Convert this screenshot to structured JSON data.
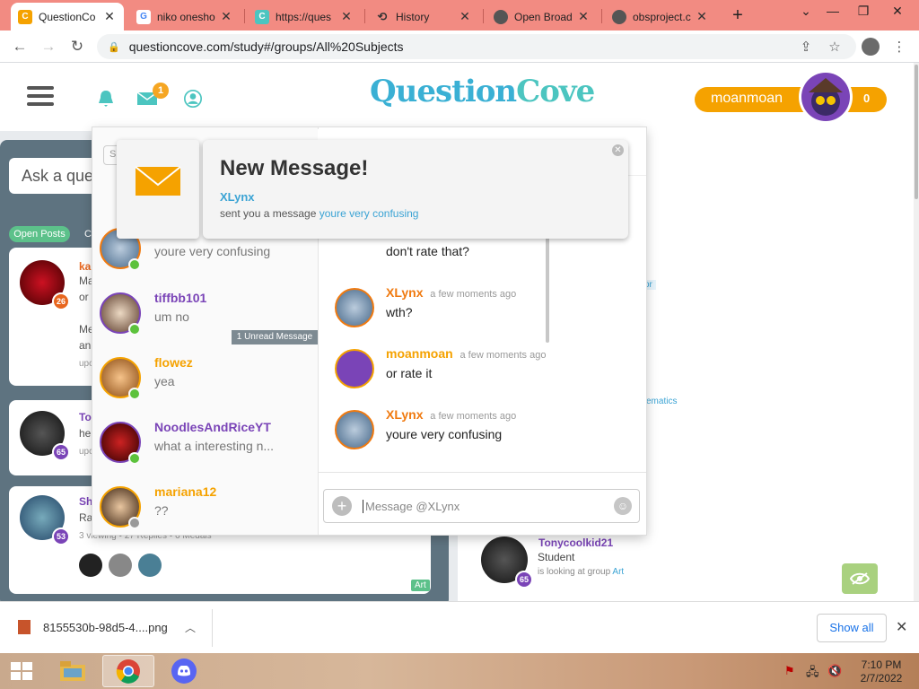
{
  "browser": {
    "tabs": [
      {
        "title": "QuestionCo",
        "active": true
      },
      {
        "title": "niko onesho"
      },
      {
        "title": "https://ques"
      },
      {
        "title": "History"
      },
      {
        "title": "Open Broad"
      },
      {
        "title": "obsproject.c"
      }
    ],
    "url": "questioncove.com/study#/groups/All%20Subjects"
  },
  "site": {
    "logo_text_a": "Question",
    "logo_text_b": "Cove",
    "mail_badge": "1",
    "username": "moanmoan",
    "points": "0",
    "ask_placeholder": "Ask a ques",
    "filters": {
      "open_posts": "Open Posts",
      "other": "Cl"
    },
    "feed": [
      {
        "user": "ka",
        "snippet1": "Ma",
        "snippet2": "or",
        "snippet3": "Me",
        "snippet4": "an",
        "meta": "upc",
        "level": "26",
        "level_color": "#e8661e"
      },
      {
        "user": "To",
        "snippet1": "hel",
        "meta": "upc",
        "level": "65",
        "level_color": "#7a44b7"
      },
      {
        "user": "Sh",
        "snippet1": "Ra",
        "meta": "3 viewing  •  27 Replies  •  6 Medals",
        "level": "53",
        "level_color": "#7a44b7"
      }
    ],
    "art_tag": "Art",
    "right_frags": [
      "or",
      "d",
      "ematics"
    ],
    "right_user": {
      "name": "Tonycoolkid21",
      "role": "Student",
      "look_text": "is looking at group",
      "look_link": "Art",
      "level": "65"
    }
  },
  "chat": {
    "search_frag": "S",
    "conversations": [
      {
        "name": "",
        "preview": "youre very confusing",
        "online": true
      },
      {
        "name": "tiffbb101",
        "preview": "um no",
        "online": true,
        "name_color": "#7a44b7"
      },
      {
        "name": "flowez",
        "preview": "yea",
        "online": true,
        "name_color": "#f5a200"
      },
      {
        "name": "NoodlesAndRiceYT",
        "preview": "what a interesting n...",
        "online": true,
        "name_color": "#7a44b7"
      },
      {
        "name": "mariana12",
        "preview": "??",
        "online": false,
        "name_color": "#f5a200"
      }
    ],
    "unread_label": "1 Unread Message",
    "messages": [
      {
        "name": "",
        "time": "",
        "text": "don't rate that?"
      },
      {
        "name": "XLynx",
        "time": "a few moments ago",
        "text": "wth?",
        "name_color": "#f07a10"
      },
      {
        "name": "moanmoan",
        "time": "a few moments ago",
        "text": "or rate it",
        "name_color": "#f5a200"
      },
      {
        "name": "XLynx",
        "time": "a few moments ago",
        "text": "youre very confusing",
        "name_color": "#f07a10"
      }
    ],
    "input_placeholder": "Message @XLynx"
  },
  "notification": {
    "title": "New Message!",
    "from": "XLynx",
    "body_prefix": "sent you a message",
    "body_link": "youre very confusing"
  },
  "downloads": {
    "file": "8155530b-98d5-4....png",
    "show_all": "Show all"
  },
  "taskbar": {
    "time": "7:10 PM",
    "date": "2/7/2022"
  },
  "colors": {
    "brand": "#3ab0d4",
    "accent": "#f5a200",
    "tabbar": "#f28b82"
  }
}
